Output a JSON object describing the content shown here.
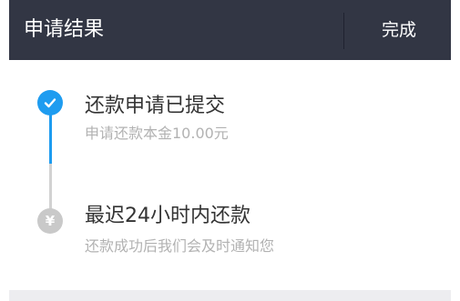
{
  "header": {
    "title": "申请结果",
    "done_label": "完成"
  },
  "steps": [
    {
      "title": "还款申请已提交",
      "subtitle": "申请还款本金10.00元",
      "state": "completed",
      "icon": "check-icon"
    },
    {
      "title": "最迟24小时内还款",
      "subtitle": "还款成功后我们会及时通知您",
      "state": "pending",
      "icon": "yen-icon",
      "icon_glyph": "¥"
    }
  ],
  "colors": {
    "header_bg": "#323644",
    "active": "#1e9cf0",
    "inactive": "#c9c9c9",
    "title_text": "#333333",
    "sub_text": "#b2b2b2"
  }
}
